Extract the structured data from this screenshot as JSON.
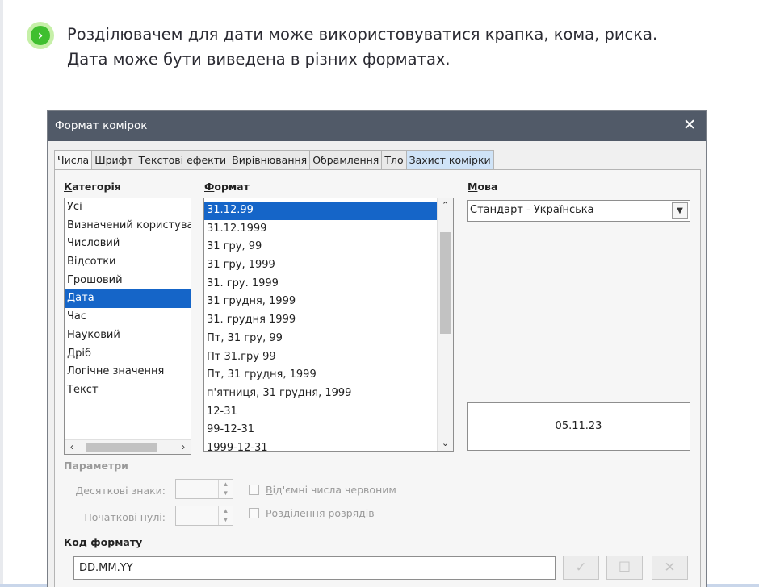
{
  "intro": {
    "line1": "Розділювачем для дати може використовуватися крапка, кома, риска.",
    "line2": "Дата може бути виведена в різних форматах."
  },
  "dialog": {
    "title": "Формат комірок",
    "close_glyph": "✕",
    "tabs": [
      "Числа",
      "Шрифт",
      "Текстові ефекти",
      "Вирівнювання",
      "Обрамлення",
      "Тло",
      "Захист комірки"
    ],
    "category": {
      "label_first": "К",
      "label_rest": "атегорія",
      "items": [
        "Усі",
        "Визначений користувач",
        "Числовий",
        "Відсотки",
        "Грошовий",
        "Дата",
        "Час",
        "Науковий",
        "Дріб",
        "Логічне значення",
        "Текст"
      ],
      "selected": "Дата"
    },
    "format": {
      "label_first": "Ф",
      "label_rest": "ормат",
      "items": [
        "31.12.99",
        "31.12.1999",
        "31 гру, 99",
        "31 гру, 1999",
        "31. гру. 1999",
        "31 грудня, 1999",
        "31. грудня 1999",
        "Пт, 31 гру, 99",
        "Пт 31.гру 99",
        "Пт, 31 грудня, 1999",
        "п'ятниця, 31 грудня, 1999",
        "12-31",
        "99-12-31",
        "1999-12-31"
      ],
      "selected": "31.12.99"
    },
    "language": {
      "label_first": "М",
      "label_rest": "ова",
      "value": "Стандарт - Українська"
    },
    "preview_value": "05.11.23",
    "options": {
      "title": "Параметри",
      "decimal_label_first": "Д",
      "decimal_label_rest": "есяткові знаки:",
      "leading_label_first": "П",
      "leading_label_rest": "очаткові нулі:",
      "negative_red_first": "В",
      "negative_red_rest": "ід'ємні числа червоним",
      "thousands_first": "Р",
      "thousands_rest": "озділення розрядів"
    },
    "format_code": {
      "label_first": "К",
      "label_rest": "од формату",
      "value": "DD.MM.YY"
    },
    "buttons": {
      "accept_glyph": "✓",
      "comment_glyph": "☐",
      "delete_glyph": "✕"
    }
  },
  "colors": {
    "selection": "#1565c8",
    "titlebar": "#515a68",
    "intro_icon": "#3fbf2f",
    "active_tab_highlight": "#cfe3f7"
  }
}
